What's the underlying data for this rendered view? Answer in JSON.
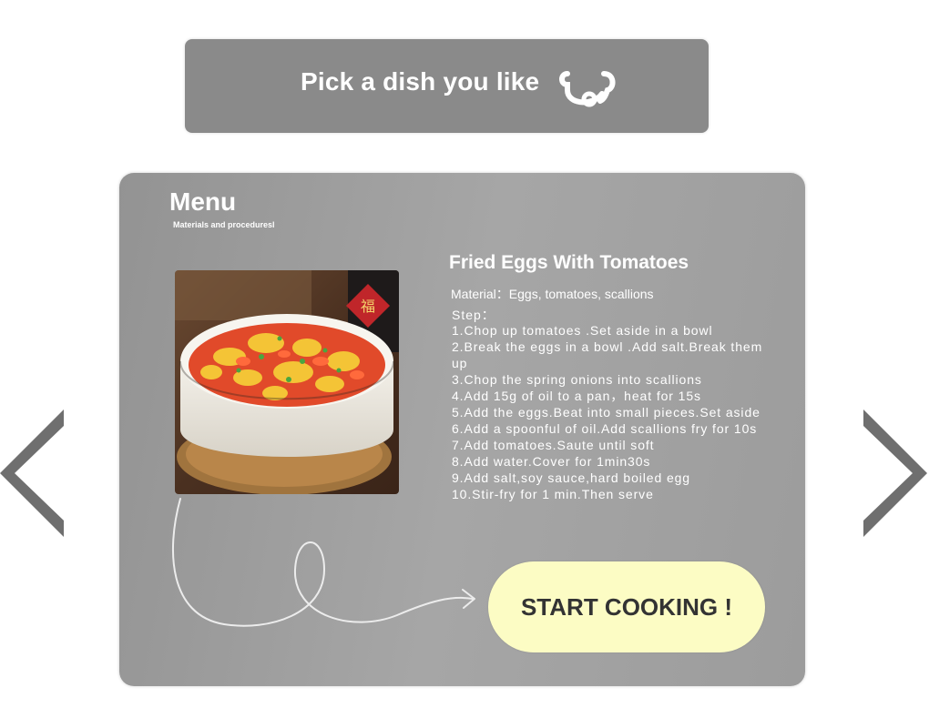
{
  "banner": {
    "title": "Pick a dish you like",
    "icon": "smile-icon"
  },
  "menu": {
    "title": "Menu",
    "subtitle": "Materials and proceduresl"
  },
  "dish": {
    "name": "Fried Eggs With Tomatoes",
    "image": "stir-fried-tomato-egg-photo",
    "material": "Material：Eggs, tomatoes, scallions",
    "step_label": "Step：",
    "steps": [
      "1.Chop up tomatoes .Set aside in a bowl",
      "2.Break the eggs in a bowl .Add salt.Break them up",
      "3.Chop the spring onions into scallions",
      "4.Add 15g of oil to a pan，heat for 15s",
      "5.Add the eggs.Beat into small pieces.Set aside",
      "6.Add a spoonful of oil.Add scallions fry for 10s",
      "7.Add tomatoes.Saute until soft",
      "8.Add water.Cover for 1min30s",
      "9.Add salt,soy sauce,hard boiled egg",
      "10.Stir-fry for 1 min.Then serve"
    ]
  },
  "actions": {
    "start_label": "START COOKING !"
  },
  "navigation": {
    "prev_icon": "chevron-left-icon",
    "next_icon": "chevron-right-icon"
  },
  "colors": {
    "banner_bg": "#8a8a8a",
    "card_bg": "#9c9c9c",
    "button_bg": "#fcfcc4",
    "button_text": "#333333",
    "arrow": "#6f6f6f"
  }
}
